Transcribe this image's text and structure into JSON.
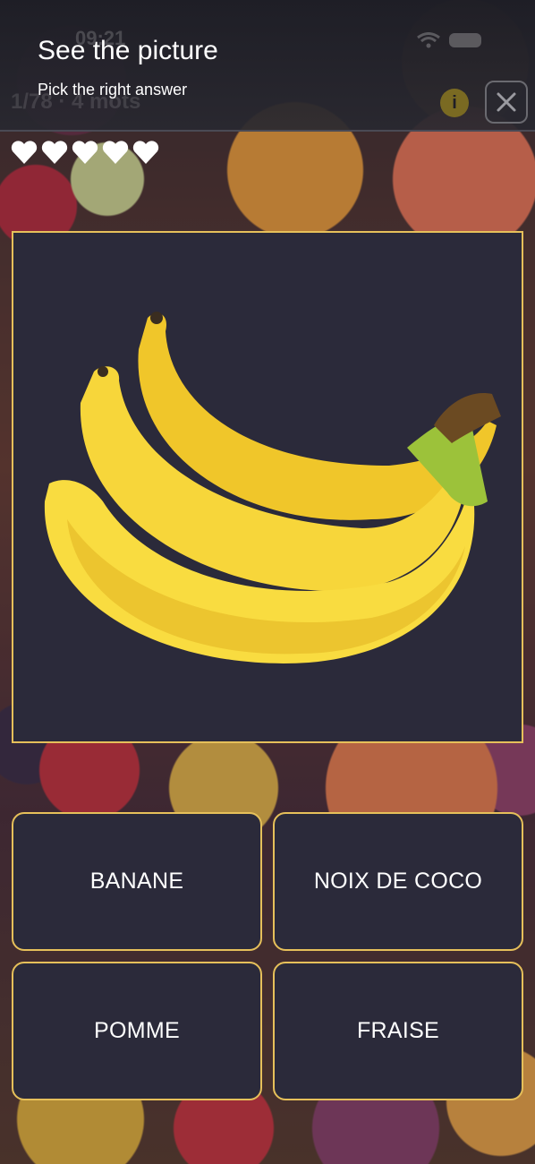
{
  "header": {
    "title": "See the picture",
    "subtitle": "Pick the right answer",
    "status_time_faded": "09:21",
    "progress_faded": "1/78 · 4 mots",
    "info_icon": "info-icon",
    "close_icon": "close-icon"
  },
  "lives": {
    "icon": "heart-icon",
    "count": 5
  },
  "question": {
    "image_subject": "banana bunch",
    "image_icon": "banana-illustration"
  },
  "answers": [
    {
      "label": "BANANE"
    },
    {
      "label": "NOIX DE COCO"
    },
    {
      "label": "POMME"
    },
    {
      "label": "FRAISE"
    }
  ],
  "colors": {
    "accent_border": "#e6c05a",
    "card_bg": "#2b2a3a",
    "banana_yellow": "#f7d63a"
  }
}
